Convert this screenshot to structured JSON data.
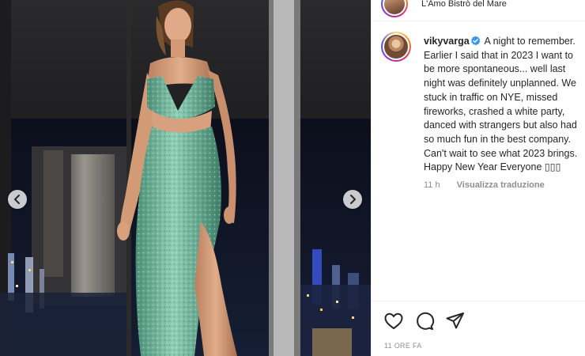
{
  "location": "L'Amo Bistrò del Mare",
  "post": {
    "username": "vikyvarga",
    "verified": true,
    "caption": "A night to remember. Earlier I said that in 2023 I want to be more spontaneous... well last night was definitely unplanned. We stuck in traffic on NYE, missed fireworks, crashed a white party, danced with strangers but also had so much fun in the best company. Can't wait to see what 2023 brings. Happy New Year Everyone",
    "caption_emoji": "▯▯▯",
    "comment_time": "11 h",
    "translate_label": "Visualizza traduzione",
    "post_time": "11 ORE FA"
  },
  "media": {
    "prev_icon": "chevron-left-icon",
    "next_icon": "chevron-right-icon",
    "dress_color": "#6fb39a"
  },
  "actions": [
    {
      "name": "like",
      "icon": "heart-icon"
    },
    {
      "name": "comment",
      "icon": "comment-icon"
    },
    {
      "name": "share",
      "icon": "paper-plane-icon"
    }
  ],
  "colors": {
    "text": "#262626",
    "muted": "#8e8e8e",
    "verified": "#3897f0"
  }
}
